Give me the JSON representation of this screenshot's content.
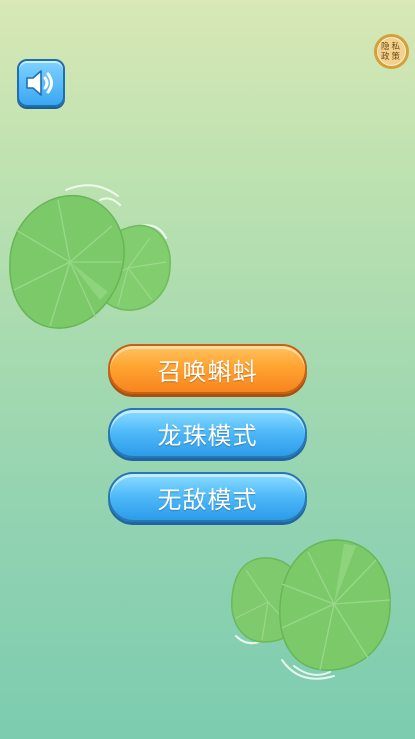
{
  "privacy_policy": {
    "line1": "隐私",
    "line2": "政策"
  },
  "sound": {
    "icon": "speaker-icon"
  },
  "menu": {
    "summon_tadpole": "召唤蝌蚪",
    "dragon_ball_mode": "龙珠模式",
    "invincible_mode": "无敌模式"
  },
  "colors": {
    "primary_button": "#f7841f",
    "secondary_button": "#4db8f8",
    "lily_pad": "#7dc96a"
  }
}
